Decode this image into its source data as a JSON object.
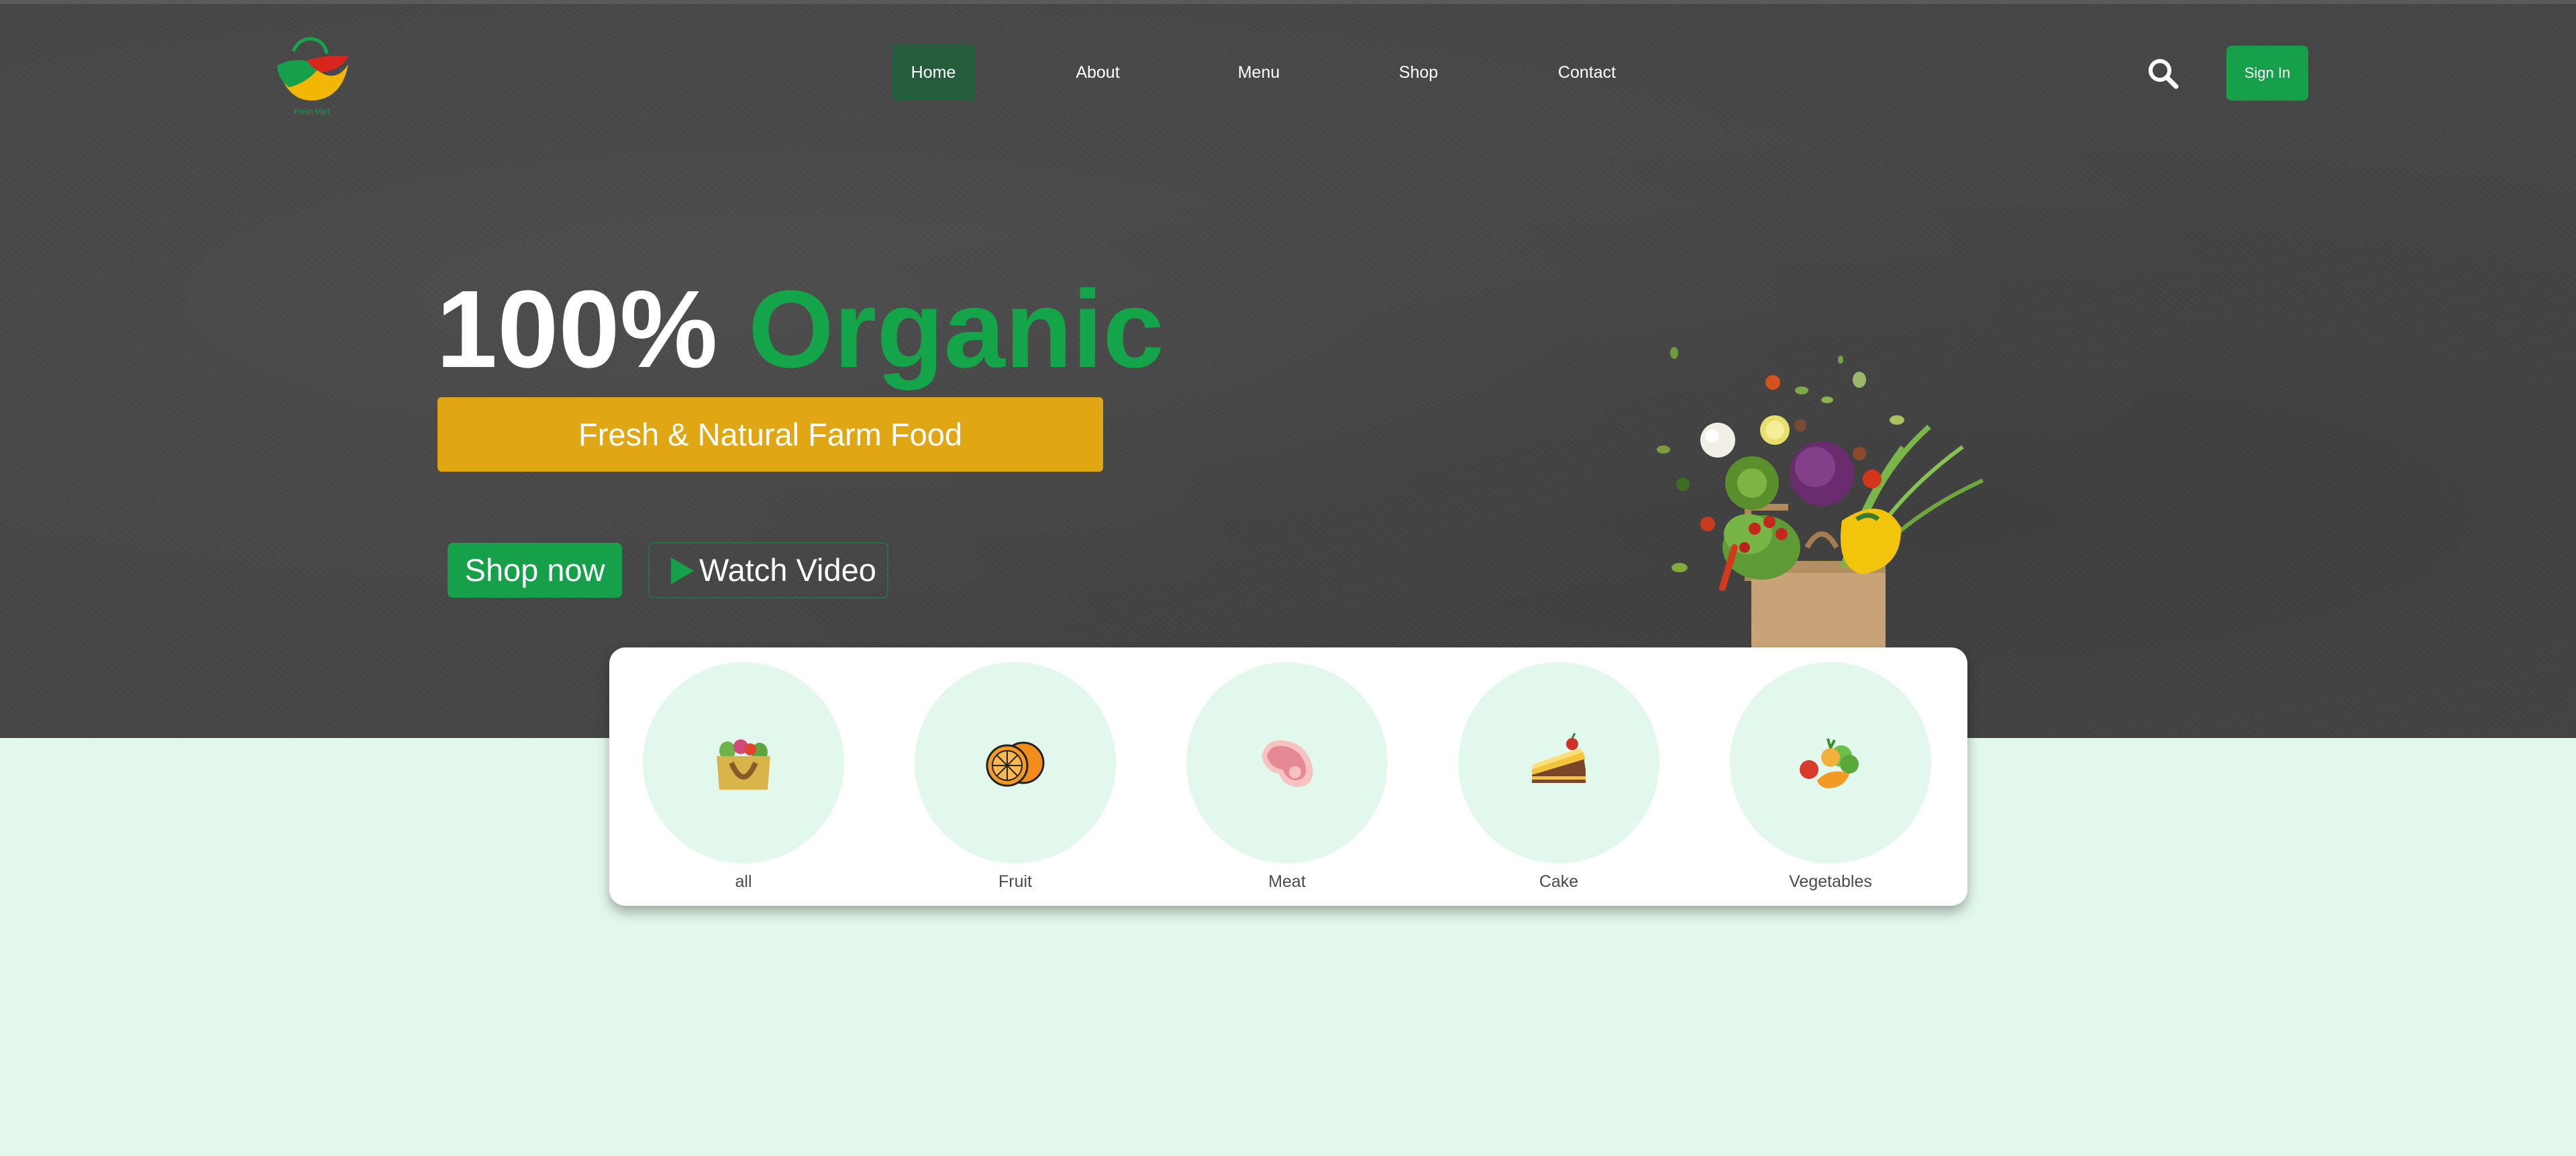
{
  "logo": {
    "caption": "Fresh Mart"
  },
  "nav": {
    "items": [
      {
        "label": "Home",
        "active": true
      },
      {
        "label": "About",
        "active": false
      },
      {
        "label": "Menu",
        "active": false
      },
      {
        "label": "Shop",
        "active": false
      },
      {
        "label": "Contact",
        "active": false
      }
    ],
    "search_icon": "search-icon",
    "sign_in_label": "Sign In"
  },
  "hero": {
    "headline_part1": "100%",
    "headline_part2": "Organic",
    "subtitle": "Fresh & Natural Farm Food",
    "shop_button": "Shop now",
    "watch_button": "Watch Video",
    "watch_icon": "play-icon",
    "image": "grocery-bag-with-vegetables"
  },
  "categories": [
    {
      "label": "all",
      "icon": "grocery-basket-icon"
    },
    {
      "label": "Fruit",
      "icon": "orange-icon"
    },
    {
      "label": "Meat",
      "icon": "steak-icon"
    },
    {
      "label": "Cake",
      "icon": "cake-slice-icon"
    },
    {
      "label": "Vegetables",
      "icon": "vegetables-icon"
    }
  ],
  "colors": {
    "brand_green": "#16a04a",
    "accent_yellow": "#e0a613",
    "hero_background": "#464646",
    "page_background": "#e3f8ec",
    "nav_active": "#245c3c"
  }
}
